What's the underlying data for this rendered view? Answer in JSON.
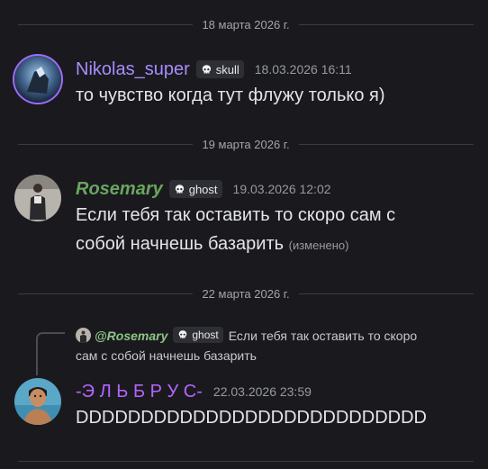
{
  "dividers": [
    "18 марта 2026 г.",
    "19 марта 2026 г.",
    "22 марта 2026 г."
  ],
  "messages": [
    {
      "username": "Nikolas_super",
      "username_color": "#a98bff",
      "tag": "skull",
      "timestamp": "18.03.2026 16:11",
      "lines": [
        "то чувство когда тут флужу только я)"
      ]
    },
    {
      "username": "Rosemary",
      "username_color": "#6aa561",
      "tag": "ghost",
      "timestamp": "19.03.2026 12:02",
      "lines": [
        "Если тебя так оставить то скоро сам с",
        "собой начнешь базарить"
      ],
      "edited": "(изменено)"
    },
    {
      "reply": {
        "name": "@Rosemary",
        "tag": "ghost",
        "text_line1": "Если тебя так оставить то скоро",
        "text_line2": "сам с собой начнешь базарить"
      },
      "username": "-Э Л Ь Б Р У С-",
      "username_color": "#b565ff",
      "timestamp": "22.03.2026 23:59",
      "lines": [
        "DDDDDDDDDDDDDDDDDDDDDDDDDDD"
      ]
    }
  ]
}
